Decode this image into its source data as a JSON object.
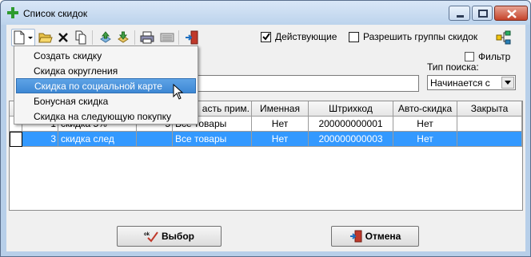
{
  "window": {
    "title": "Список скидок",
    "controls": {
      "minimize": "minimize",
      "maximize": "maximize",
      "close": "close"
    }
  },
  "toolbar": {
    "buttons": [
      "new-doc-icon",
      "open-folder-icon",
      "delete-x-icon",
      "copy-icon",
      "upload-icon",
      "download-icon",
      "print-icon",
      "keyboard-icon",
      "exit-door-icon"
    ],
    "active_label": "Действующие",
    "active_checked": true,
    "groups_label": "Разрешить группы скидок",
    "groups_checked": false
  },
  "filter": {
    "label": "Фильтр",
    "checked": false,
    "search_value": "",
    "search_type_label": "Тип поиска:",
    "search_type_value": "Начинается с"
  },
  "menu": {
    "items": [
      "Создать скидку",
      "Скидка округления",
      "Скидка по социальной карте",
      "Бонусная скидка",
      "Скидка на следующую покупку"
    ],
    "highlighted_index": 2
  },
  "grid": {
    "columns": [
      "",
      "",
      "",
      "асть прим.",
      "Именная",
      "Штрихкод",
      "Авто-скидка",
      "Закрыта"
    ],
    "rows": [
      {
        "n": "1",
        "name": "скидка 5%",
        "pct": "5",
        "scope": "Все товары",
        "named": "Нет",
        "barcode": "200000000001",
        "auto": "Нет",
        "closed": ""
      },
      {
        "n": "3",
        "name": "скидка след",
        "pct": "",
        "scope": "Все товары",
        "named": "Нет",
        "barcode": "200000000003",
        "auto": "Нет",
        "closed": ""
      }
    ]
  },
  "buttons": {
    "select": "Выбор",
    "cancel": "Отмена"
  },
  "colors": {
    "selection": "#3399ff",
    "menu_highlight": "#4a90d9"
  }
}
